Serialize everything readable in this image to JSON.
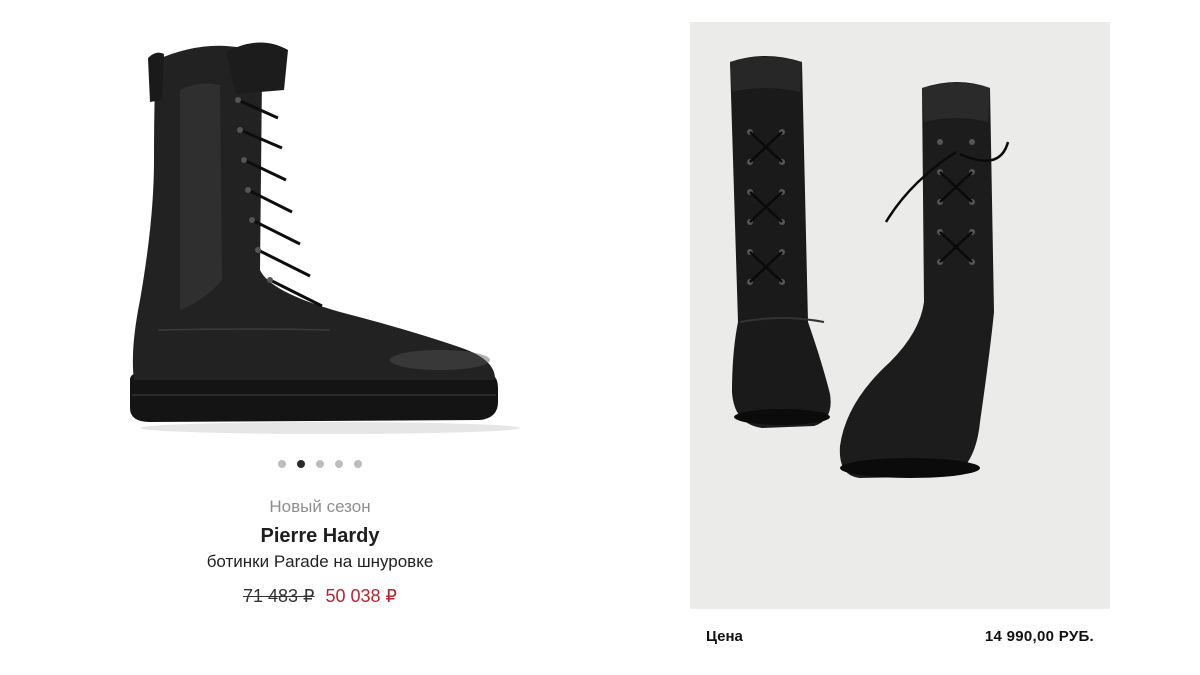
{
  "left_product": {
    "season": "Новый сезон",
    "brand": "Pierre Hardy",
    "model": "ботинки Parade на шнуровке",
    "old_price": "71 483 ₽",
    "new_price": "50 038 ₽",
    "carousel": {
      "count": 5,
      "active": 2
    }
  },
  "right_product": {
    "price_label": "Цена",
    "price_value": "14 990,00  РУБ."
  },
  "colors": {
    "sale_price": "#b3262e",
    "right_image_bg": "#ebebea",
    "dot_active": "#2b2b2b",
    "dot_inactive": "#bdbdbd"
  }
}
